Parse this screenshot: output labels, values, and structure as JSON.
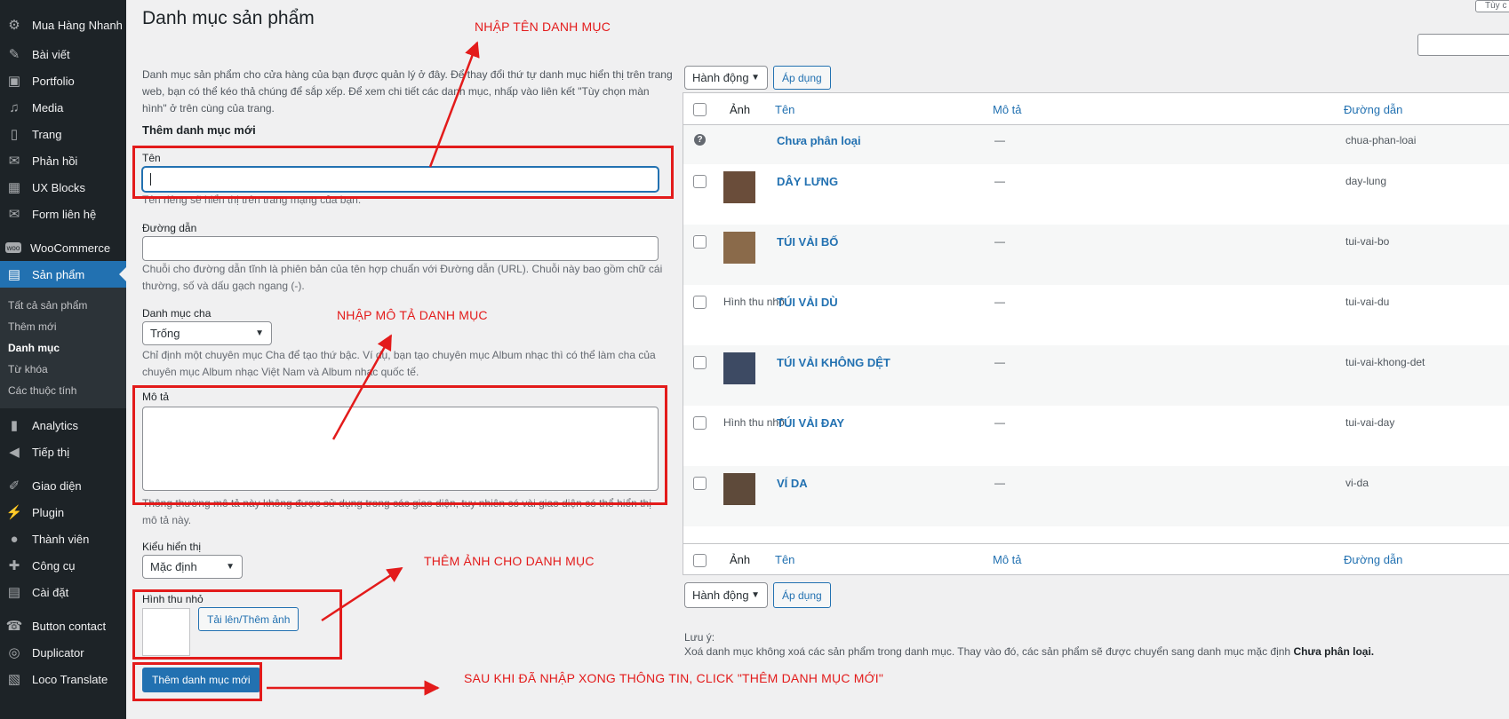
{
  "sidebar": {
    "site_name": "Mua Hàng Nhanh",
    "items_a": [
      {
        "icon": "pin-icon",
        "label": "Bài viết"
      },
      {
        "icon": "portfolio-icon",
        "label": "Portfolio"
      },
      {
        "icon": "media-icon",
        "label": "Media"
      },
      {
        "icon": "page-icon",
        "label": "Trang"
      },
      {
        "icon": "comment-icon",
        "label": "Phản hồi"
      },
      {
        "icon": "blocks-icon",
        "label": "UX Blocks"
      },
      {
        "icon": "mail-icon",
        "label": "Form liên hệ"
      }
    ],
    "woocommerce": "WooCommerce",
    "products": "Sản phẩm",
    "sub": [
      "Tất cả sản phẩm",
      "Thêm mới",
      "Danh mục",
      "Từ khóa",
      "Các thuộc tính"
    ],
    "items_b": [
      {
        "icon": "analytics-icon",
        "label": "Analytics"
      },
      {
        "icon": "megaphone-icon",
        "label": "Tiếp thị"
      }
    ],
    "items_c": [
      {
        "icon": "brush-icon",
        "label": "Giao diện"
      },
      {
        "icon": "plugin-icon",
        "label": "Plugin"
      },
      {
        "icon": "user-icon",
        "label": "Thành viên"
      },
      {
        "icon": "wrench-icon",
        "label": "Công cụ"
      },
      {
        "icon": "settings-icon",
        "label": "Cài đặt"
      }
    ],
    "items_d": [
      {
        "icon": "phone-icon",
        "label": "Button contact"
      },
      {
        "icon": "duplicator-icon",
        "label": "Duplicator"
      },
      {
        "icon": "translate-icon",
        "label": "Loco Translate"
      }
    ]
  },
  "page": {
    "title": "Danh mục sản phẩm",
    "intro": "Danh mục sản phẩm cho cửa hàng của bạn được quản lý ở đây. Để thay đổi thứ tự danh mục hiển thị trên trang web, bạn có thể kéo thả chúng để sắp xếp. Để xem chi tiết các danh mục, nhấp vào liên kết \"Tùy chọn màn hình\" ở trên cùng của trang.",
    "top_right_button": "Tùy c"
  },
  "form": {
    "section_title": "Thêm danh mục mới",
    "name_label": "Tên",
    "name_value": "",
    "name_desc": "Tên riêng sẽ hiển thị trên trang mạng của bạn.",
    "slug_label": "Đường dẫn",
    "slug_value": "",
    "slug_desc": "Chuỗi cho đường dẫn tĩnh là phiên bản của tên hợp chuẩn với Đường dẫn (URL). Chuỗi này bao gồm chữ cái thường, số và dấu gạch ngang (-).",
    "parent_label": "Danh mục cha",
    "parent_value": "Trống",
    "parent_desc": "Chỉ định một chuyên mục Cha để tạo thứ bậc. Ví dụ, bạn tạo chuyên mục Album nhạc thì có thể làm cha của chuyên mục Album nhạc Việt Nam và Album nhạc quốc tế.",
    "desc_label": "Mô tả",
    "desc_value": "",
    "desc_desc": "Thông thường mô tả này không được sử dụng trong các giao diện, tuy nhiên có vài giao diện có thể hiển thị mô tả này.",
    "display_label": "Kiểu hiển thị",
    "display_value": "Mặc định",
    "thumb_label": "Hình thu nhỏ",
    "upload_button": "Tải lên/Thêm ảnh",
    "submit_button": "Thêm danh mục mới"
  },
  "annotations": {
    "name": "NHẬP TÊN DANH MỤC",
    "desc": "NHẬP MÔ TẢ DANH MỤC",
    "image": "THÊM ẢNH CHO DANH MỤC",
    "submit": "SAU KHI ĐÃ NHẬP XONG THÔNG TIN, CLICK \"THÊM DANH MỤC MỚI\""
  },
  "bulk": {
    "action_label": "Hành động",
    "apply_label": "Áp dụng"
  },
  "table": {
    "columns": [
      "Ảnh",
      "Tên",
      "Mô tả",
      "Đường dẫn"
    ],
    "rows": [
      {
        "name": "Chưa phân loại",
        "desc": "—",
        "slug": "chua-phan-loai",
        "image": "none",
        "broken_alt": ""
      },
      {
        "name": "DÂY LƯNG",
        "desc": "—",
        "slug": "day-lung",
        "image": "photo",
        "color": "#6a4d3a",
        "broken_alt": ""
      },
      {
        "name": "TÚI VẢI BỐ",
        "desc": "—",
        "slug": "tui-vai-bo",
        "image": "photo",
        "color": "#8a6a4a",
        "broken_alt": ""
      },
      {
        "name": "TÚI VẢI DÙ",
        "desc": "—",
        "slug": "tui-vai-du",
        "image": "broken",
        "broken_alt": "Hình thu nhỏ"
      },
      {
        "name": "TÚI VẢI KHÔNG DỆT",
        "desc": "—",
        "slug": "tui-vai-khong-det",
        "image": "photo",
        "color": "#3d4a63",
        "broken_alt": ""
      },
      {
        "name": "TÚI VẢI ĐAY",
        "desc": "—",
        "slug": "tui-vai-day",
        "image": "broken",
        "broken_alt": "Hình thu nhỏ"
      },
      {
        "name": "VÍ DA",
        "desc": "—",
        "slug": "vi-da",
        "image": "photo",
        "color": "#5e4a3a",
        "broken_alt": ""
      }
    ]
  },
  "note": {
    "title": "Lưu ý:",
    "text": "Xoá danh mục không xoá các sản phẩm trong danh mục. Thay vào đó, các sản phẩm sẽ được chuyển sang danh mục mặc định",
    "bold": "Chưa phân loại."
  }
}
